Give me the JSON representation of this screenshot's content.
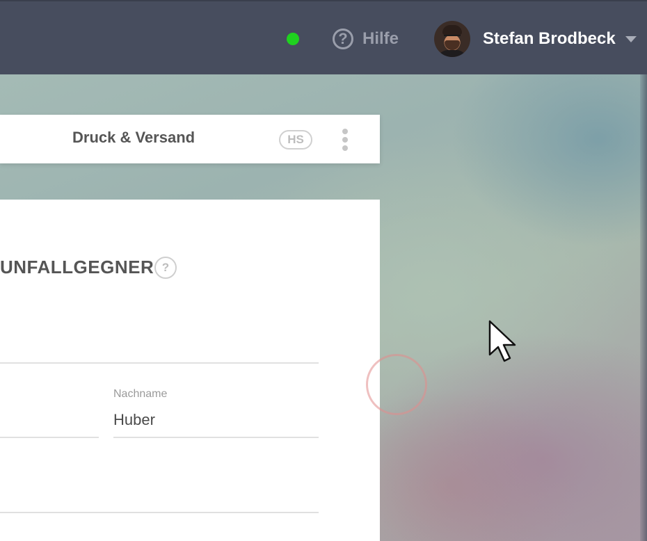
{
  "topbar": {
    "status_color": "#1fd21f",
    "help_label": "Hilfe",
    "help_icon": "?",
    "user_name": "Stefan Brodbeck"
  },
  "card": {
    "title": "Druck & Versand",
    "badge": "HS"
  },
  "form": {
    "section_title": "UNFALLGEGNER",
    "section_help_icon": "?",
    "lastname_label": "Nachname",
    "lastname_value": "Huber"
  },
  "colors": {
    "topbar_bg": "#474d5e",
    "card_bg": "#ffffff",
    "text_dark": "#555555"
  }
}
